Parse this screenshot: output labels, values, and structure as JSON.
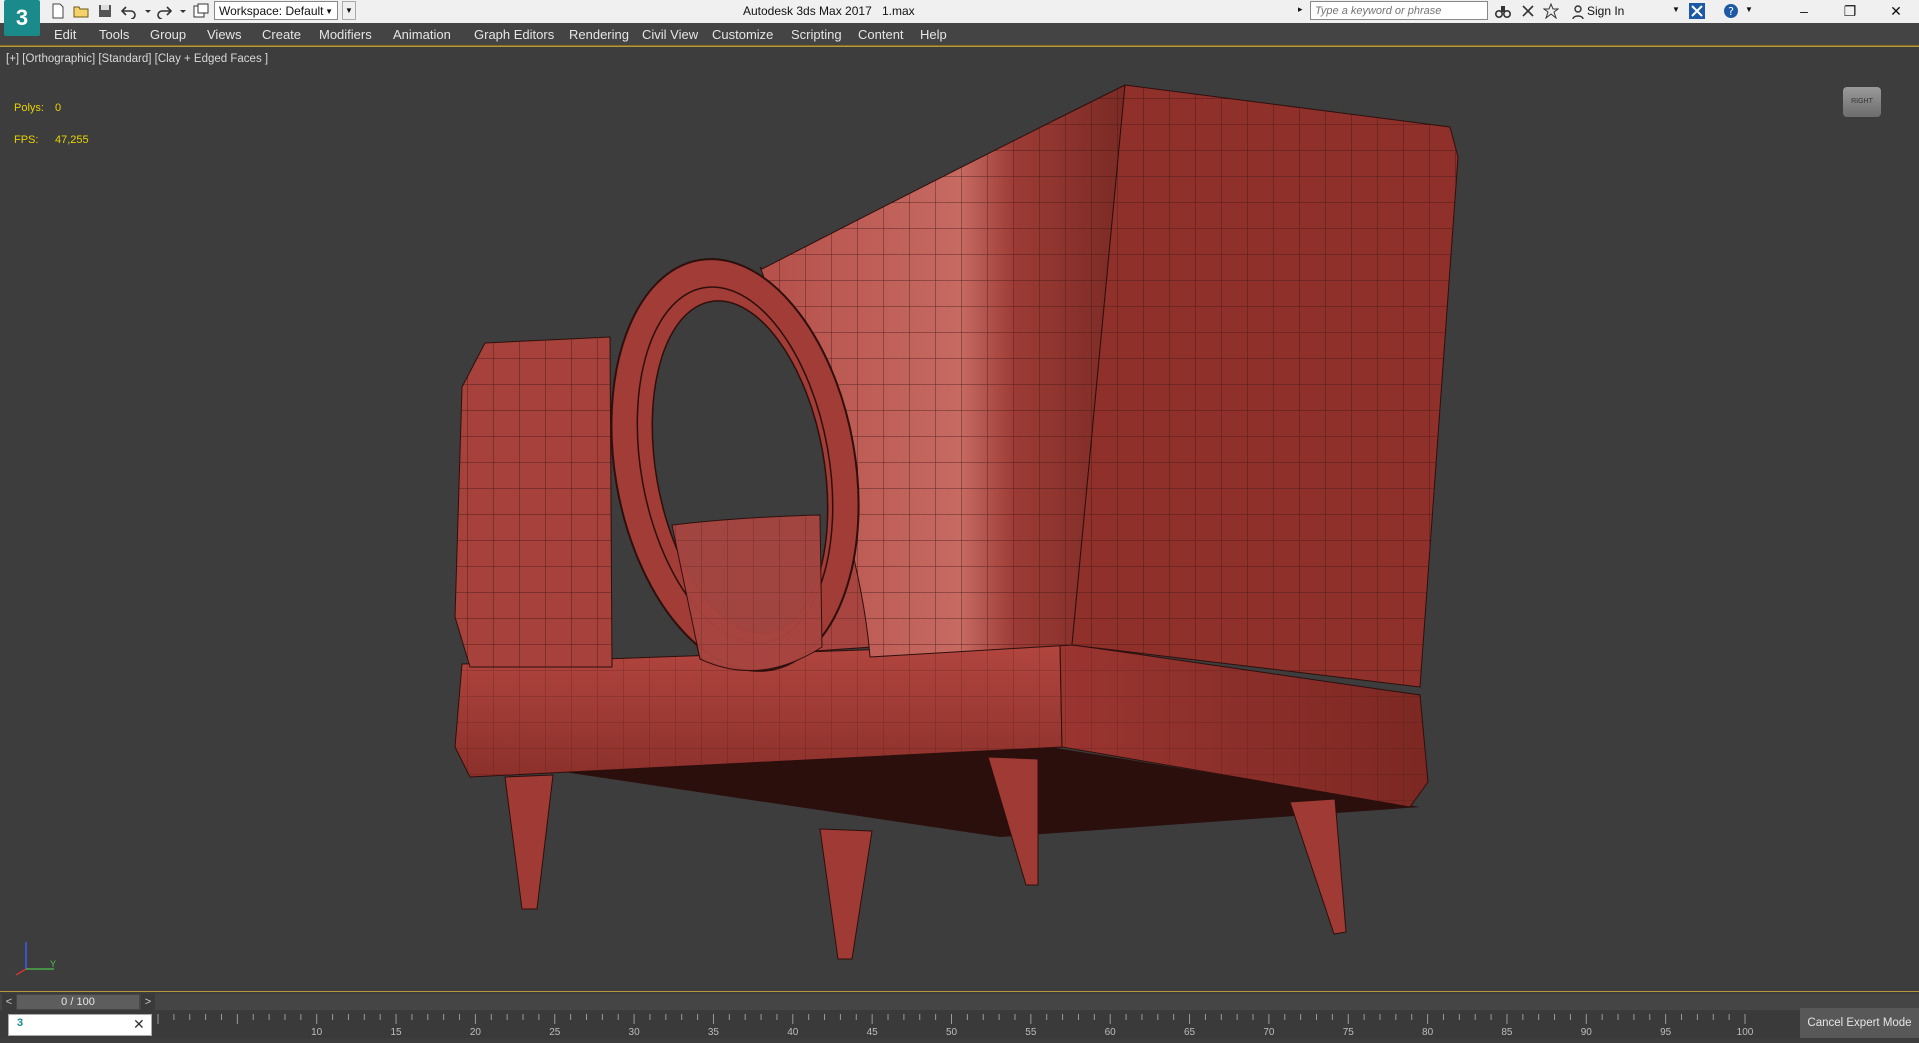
{
  "titlebar": {
    "app_title": "Autodesk 3ds Max 2017",
    "file_name": "1.max",
    "workspace_label": "Workspace: Default",
    "search_placeholder": "Type a keyword or phrase",
    "sign_in": "Sign In",
    "logo_text": "3",
    "minimize": "–",
    "restore": "❐",
    "close": "✕"
  },
  "menu": {
    "items": [
      "Edit",
      "Tools",
      "Group",
      "Views",
      "Create",
      "Modifiers",
      "Animation",
      "Graph Editors",
      "Rendering",
      "Civil View",
      "Customize",
      "Scripting",
      "Content",
      "Help"
    ]
  },
  "viewport": {
    "label": "[+] [Orthographic] [Standard] [Clay + Edged Faces ]",
    "polys_label": "Polys:",
    "polys_value": "0",
    "fps_label": "FPS:",
    "fps_value": "47,255",
    "viewcube_label": "RIGHT",
    "axis_label": "Y"
  },
  "timeline": {
    "frame_readout": "0 / 100",
    "prev": "<",
    "next": ">",
    "ticks": [
      "10",
      "15",
      "20",
      "25",
      "30",
      "35",
      "40",
      "45",
      "50",
      "55",
      "60",
      "65",
      "70",
      "75",
      "80",
      "85",
      "90",
      "95",
      "100"
    ]
  },
  "status": {
    "cancel_expert_mode": "Cancel Expert Mode"
  },
  "colors": {
    "viewport_bg": "#3d3d3d",
    "model_red": "#a8403a",
    "stats_yellow": "#e8d200",
    "border_gold": "#b49a3a"
  }
}
